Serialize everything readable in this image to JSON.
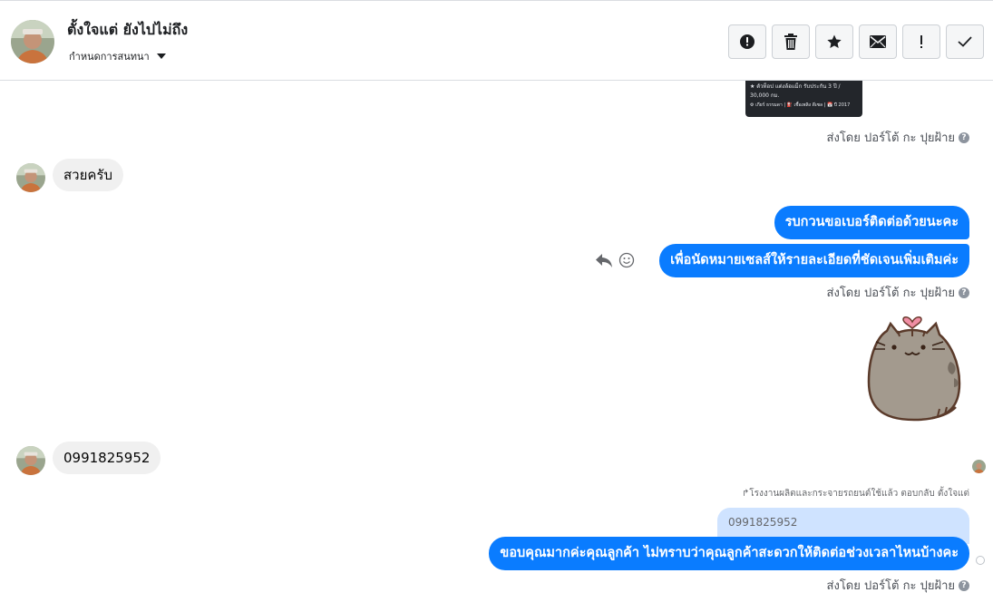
{
  "header": {
    "contact_name": "ตั้งใจแต่ ยังไปไม่ถึง",
    "subtitle": "กำหนดการสนทนา",
    "toolbar": {
      "report_icon": "exclamation-circle-icon",
      "delete_icon": "trash-icon",
      "star_icon": "star-icon",
      "mail_icon": "envelope-icon",
      "important_icon": "exclamation-icon",
      "done_icon": "checkmark-icon"
    }
  },
  "thumbnail": {
    "line1": "★ ตัวท็อป แต่งล้อแม็ก รับประกัน 3 ปี /",
    "line2": "30,000 กม.",
    "line3": "⚙ เกียร์ ธรรมดา  |  ⛽ เชื้อเพลิง ดีเซล  |  📅 ปี 2017"
  },
  "messages": {
    "sent_by_1": "ส่งโดย ปอร์โต้ กะ ปุยฝ้าย",
    "incoming_1": "สวยครับ",
    "outgoing_1": "รบกวนขอเบอร์ติดต่อด้วยนะคะ",
    "outgoing_2": "เพื่อนัดหมายเซลส์ให้รายละเอียดที่ชัดเจนเพิ่มเติมค่ะ",
    "sent_by_2": "ส่งโดย ปอร์โต้ กะ ปุยฝ้าย",
    "sticker": "pusheen-cat-heart-sticker",
    "incoming_2": "0991825952",
    "reply_label": "↱โรงงานผลิตและกระจายรถยนต์ใช้แล้ว ตอบกลับ ตั้งใจแต่",
    "quoted_text": "0991825952",
    "outgoing_3": "ขอบคุณมากค่ะคุณลูกค้า ไม่ทราบว่าคุณลูกค้าสะดวกให้ติดต่อช่วงเวลาไหนบ้างคะ",
    "sent_by_3": "ส่งโดย ปอร์โต้ กะ ปุยฝ้าย",
    "help_glyph": "?"
  },
  "colors": {
    "outgoing_bubble": "#0a7cff",
    "incoming_bubble": "#f0f0f0",
    "quoted_bubble": "#cfe3ff"
  }
}
